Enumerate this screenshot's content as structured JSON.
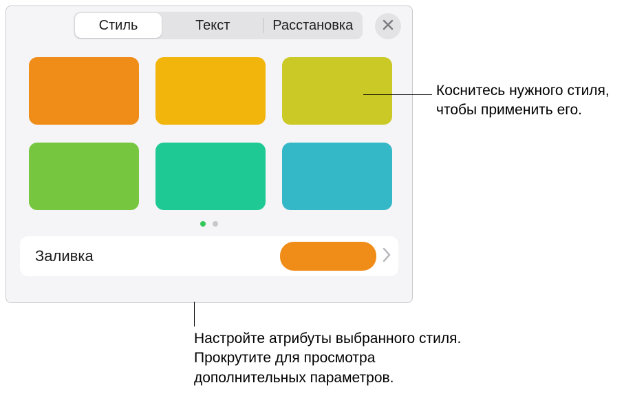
{
  "tabs": {
    "style": "Стиль",
    "text": "Текст",
    "arrange": "Расстановка"
  },
  "colors": {
    "swatch1": "#f08c18",
    "swatch2": "#f2b50c",
    "swatch3": "#cac926",
    "swatch4": "#77c63f",
    "swatch5": "#1ec994",
    "swatch6": "#34b7c7",
    "fill": "#f08c18"
  },
  "fill": {
    "label": "Заливка"
  },
  "callouts": {
    "right": "Коснитесь нужного стиля, чтобы применить его.",
    "bottom": "Настройте атрибуты выбранного стиля. Прокрутите для просмотра дополнительных параметров."
  }
}
